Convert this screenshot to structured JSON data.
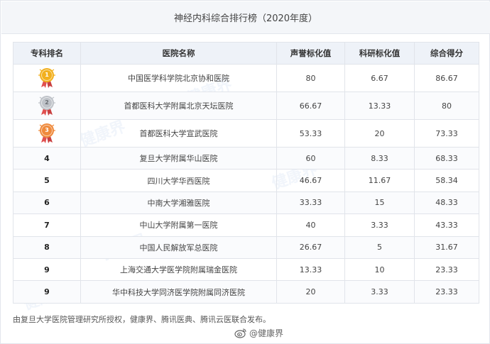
{
  "title": "神经内科综合排行榜（2020年度）",
  "table": {
    "headers": [
      "专科排名",
      "医院名称",
      "声誉标化值",
      "科研标化值",
      "综合得分"
    ],
    "rows": [
      {
        "rank": "1",
        "medal": "gold",
        "name": "中国医学科学院北京协和医院",
        "reputation": "80",
        "research": "6.67",
        "score": "86.67"
      },
      {
        "rank": "2",
        "medal": "silver",
        "name": "首都医科大学附属北京天坛医院",
        "reputation": "66.67",
        "research": "13.33",
        "score": "80"
      },
      {
        "rank": "3",
        "medal": "bronze",
        "name": "首都医科大学宣武医院",
        "reputation": "53.33",
        "research": "20",
        "score": "73.33"
      },
      {
        "rank": "4",
        "medal": "",
        "name": "复旦大学附属华山医院",
        "reputation": "60",
        "research": "8.33",
        "score": "68.33"
      },
      {
        "rank": "5",
        "medal": "",
        "name": "四川大学华西医院",
        "reputation": "46.67",
        "research": "11.67",
        "score": "58.34"
      },
      {
        "rank": "6",
        "medal": "",
        "name": "中南大学湘雅医院",
        "reputation": "33.33",
        "research": "15",
        "score": "48.33"
      },
      {
        "rank": "7",
        "medal": "",
        "name": "中山大学附属第一医院",
        "reputation": "40",
        "research": "3.33",
        "score": "43.33"
      },
      {
        "rank": "8",
        "medal": "",
        "name": "中国人民解放军总医院",
        "reputation": "26.67",
        "research": "5",
        "score": "31.67"
      },
      {
        "rank": "9",
        "medal": "",
        "name": "上海交通大学医学院附属瑞金医院",
        "reputation": "13.33",
        "research": "10",
        "score": "23.33"
      },
      {
        "rank": "9",
        "medal": "",
        "name": "华中科技大学同济医学院附属同济医院",
        "reputation": "20",
        "research": "3.33",
        "score": "23.33"
      }
    ]
  },
  "footer_note": "由复旦大学医院管理研究所授权，健康界、腾讯医典、腾讯云医联合发布。",
  "watermark": {
    "icon": "weibo-icon",
    "text": "@健康界",
    "bg_text": "健康界"
  },
  "colors": {
    "gold": "#f2b01e",
    "silver": "#bfc3c9",
    "bronze": "#ef8a3c",
    "header_bg": "#eef2f8",
    "title_bg": "#f4f6f9",
    "border": "#e1e4ea"
  }
}
